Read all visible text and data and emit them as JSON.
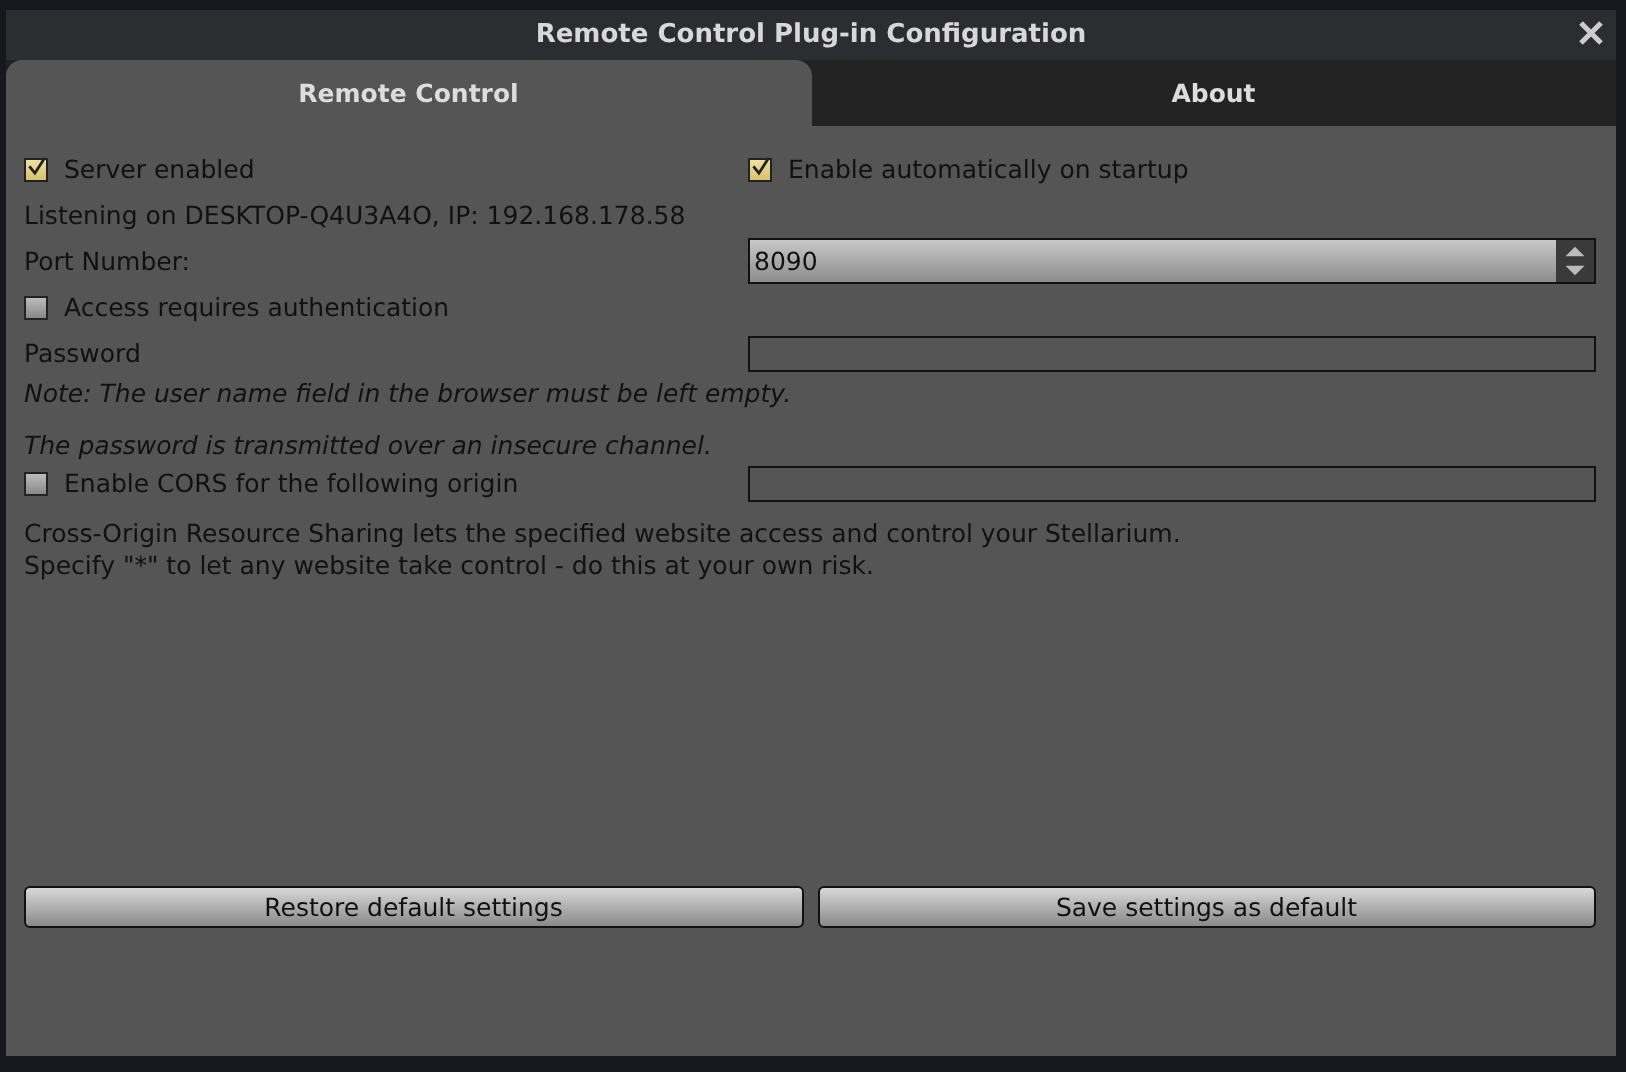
{
  "window": {
    "title": "Remote Control Plug-in Configuration"
  },
  "tabs": [
    {
      "label": "Remote Control",
      "selected": true
    },
    {
      "label": "About",
      "selected": false
    }
  ],
  "server_enabled": {
    "label": "Server enabled",
    "checked": true
  },
  "auto_start": {
    "label": "Enable automatically on startup",
    "checked": true
  },
  "listening": "Listening on DESKTOP-Q4U3A4O, IP: 192.168.178.58",
  "port": {
    "label": "Port Number:",
    "value": "8090"
  },
  "authentication": {
    "label": "Access requires authentication",
    "checked": false
  },
  "password": {
    "label": "Password"
  },
  "notes": [
    "Note: The user name field in the browser must be left empty.",
    "The password is transmitted over an insecure channel."
  ],
  "cors": {
    "label": "Enable CORS for the following origin",
    "checked": false
  },
  "cors_description": [
    "Cross-Origin Resource Sharing lets the specified website access and control your Stellarium.",
    "Specify \"*\" to let any website take control - do this at your own risk."
  ],
  "buttons": [
    "Restore default settings",
    "Save settings as default"
  ]
}
